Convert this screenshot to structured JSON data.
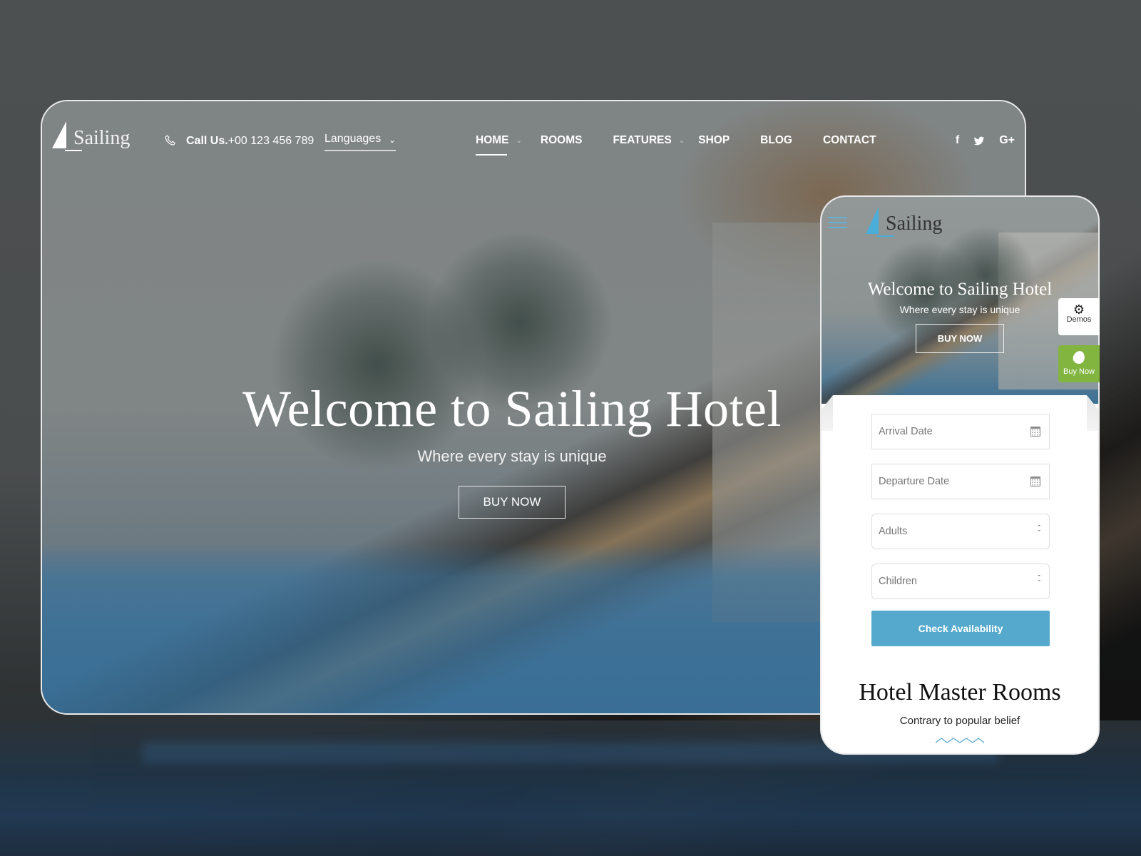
{
  "desktop": {
    "brand": "Sailing",
    "call_label": "Call Us.",
    "phone_number": "+00 123 456 789",
    "languages_label": "Languages",
    "nav": [
      {
        "label": "HOME",
        "active": true,
        "has_dropdown": true
      },
      {
        "label": "ROOMS",
        "active": false,
        "has_dropdown": false
      },
      {
        "label": "FEATURES",
        "active": false,
        "has_dropdown": true
      },
      {
        "label": "SHOP",
        "active": false,
        "has_dropdown": false
      },
      {
        "label": "BLOG",
        "active": false,
        "has_dropdown": false
      },
      {
        "label": "CONTACT",
        "active": false,
        "has_dropdown": false
      }
    ],
    "social": [
      {
        "icon": "facebook-icon",
        "glyph": "f"
      },
      {
        "icon": "twitter-icon",
        "glyph": "🐦"
      },
      {
        "icon": "google-plus-icon",
        "glyph": "G+"
      }
    ],
    "hero": {
      "title": "Welcome to Sailing Hotel",
      "subtitle": "Where every stay is unique",
      "button": "BUY NOW"
    }
  },
  "mobile": {
    "brand": "Sailing",
    "hero": {
      "title": "Welcome to Sailing Hotel",
      "subtitle": "Where every stay is unique",
      "button": "BUY NOW"
    },
    "side_buttons": {
      "demos_label": "Demos",
      "buy_label": "Buy Now"
    },
    "form": {
      "arrival_placeholder": "Arrival Date",
      "departure_placeholder": "Departure Date",
      "adults_placeholder": "Adults",
      "children_placeholder": "Children",
      "submit_label": "Check Availability"
    },
    "rooms_section": {
      "title": "Hotel Master Rooms",
      "subtitle": "Contrary to popular belief"
    }
  },
  "colors": {
    "accent_blue": "#54a9cd",
    "logo_blue": "#4aaed8",
    "buy_green": "#82b540"
  }
}
